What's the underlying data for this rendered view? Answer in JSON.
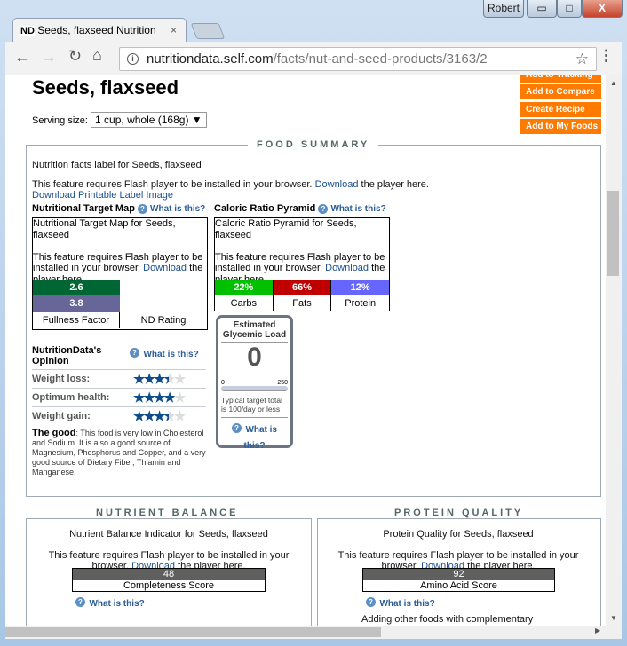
{
  "window": {
    "user": "Robert",
    "minimize": "▭",
    "maximize": "□",
    "close": "X"
  },
  "tab": {
    "favicon": "ND",
    "title": "Seeds, flaxseed Nutrition",
    "close": "×"
  },
  "address": {
    "domain": "nutritiondata.self.com",
    "path": "/facts/nut-and-seed-products/3163/2"
  },
  "page": {
    "title": "Seeds, flaxseed",
    "serving_label": "Serving size:",
    "serving_value": "1 cup, whole (168g)",
    "buttons": [
      "Add to Tracking",
      "Add to Compare",
      "Create Recipe",
      "Add to My Foods"
    ],
    "food_summary": {
      "legend": "FOOD SUMMARY",
      "label_text": "Nutrition facts label for Seeds, flaxseed",
      "flash_text": "This feature requires Flash player to be installed in your browser.",
      "download": "Download",
      "flash_tail": "the player here.",
      "printable": "Download Printable Label Image",
      "what": "What is this?",
      "target_map": {
        "title": "Nutritional Target Map",
        "caption": "Nutritional Target Map for Seeds, flaxseed",
        "flash": "This feature requires Flash player to be installed in your browser.",
        "download": "Download",
        "tail": "the player here.",
        "fullness_value": "2.6",
        "nd_value": "3.8",
        "fullness_label": "Fullness Factor",
        "nd_label": "ND Rating"
      },
      "pyramid": {
        "title": "Caloric Ratio Pyramid",
        "caption": "Caloric Ratio Pyramid for Seeds, flaxseed",
        "flash": "This feature requires Flash player to be installed in your browser.",
        "download": "Download",
        "tail": "the player here.",
        "items": [
          {
            "label": "Carbs",
            "value": "22%",
            "color": "#00c000"
          },
          {
            "label": "Fats",
            "value": "66%",
            "color": "#c00000"
          },
          {
            "label": "Protein",
            "value": "12%",
            "color": "#6666ff"
          }
        ]
      },
      "opinion": {
        "title": "NutritionData's Opinion",
        "rows": [
          {
            "label": "Weight loss:",
            "stars": 3.5
          },
          {
            "label": "Optimum health:",
            "stars": 4
          },
          {
            "label": "Weight gain:",
            "stars": 3.5
          }
        ],
        "good_label": "The good",
        "good_text": ": This food is very low in Cholesterol and Sodium. It is also a good source of Magnesium, Phosphorus and Copper, and a very good source of Dietary Fiber, Thiamin and Manganese."
      },
      "glycemic": {
        "title": "Estimated Glycemic Load",
        "value": "0",
        "min": "0",
        "max": "250",
        "note": "Typical target total is 100/day or less"
      }
    },
    "nutrient_balance": {
      "legend": "NUTRIENT BALANCE",
      "caption": "Nutrient Balance Indicator for Seeds, flaxseed",
      "flash": "This feature requires Flash player to be installed in your browser.",
      "download": "Download",
      "tail": "the player here.",
      "score": "48",
      "score_label": "Completeness Score"
    },
    "protein_quality": {
      "legend": "PROTEIN QUALITY",
      "caption": "Protein Quality for Seeds, flaxseed",
      "flash": "This feature requires Flash player to be installed in your browser.",
      "download": "Download",
      "tail": "the player here.",
      "score": "92",
      "score_label": "Amino Acid Score",
      "more": "Adding other foods with complementary"
    }
  }
}
